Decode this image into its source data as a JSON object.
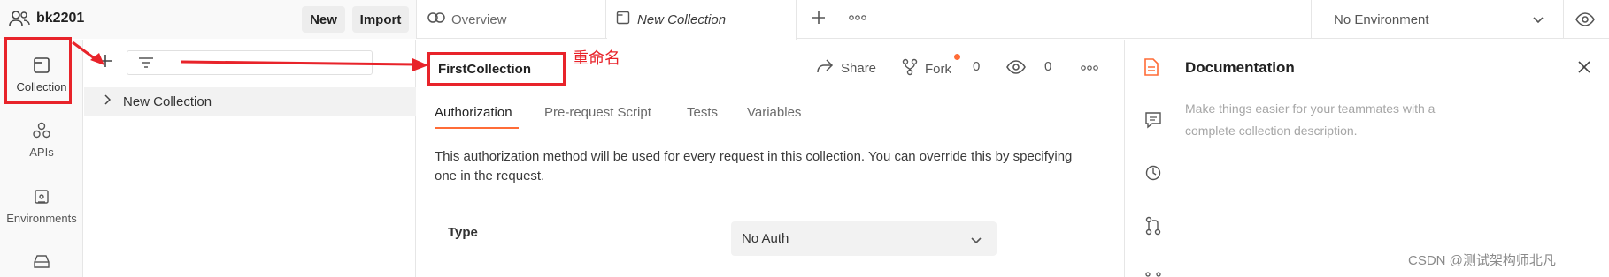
{
  "workspace": {
    "name": "bk2201",
    "new_label": "New",
    "import_label": "Import"
  },
  "tabs": [
    {
      "label": "Overview",
      "icon": "overview-icon"
    },
    {
      "label": "New Collection",
      "icon": "collection-tab-icon",
      "active": true
    }
  ],
  "environment": {
    "selected": "No Environment"
  },
  "rail": [
    {
      "label": "Collection",
      "icon": "collection-icon",
      "active": true
    },
    {
      "label": "APIs",
      "icon": "apis-icon"
    },
    {
      "label": "Environments",
      "icon": "environments-icon"
    }
  ],
  "sidebar": {
    "tree_item": "New Collection"
  },
  "collection": {
    "name_value": "FirstCollection",
    "share_label": "Share",
    "fork_label": "Fork",
    "fork_count": "0",
    "watch_count": "0"
  },
  "subtabs": [
    "Authorization",
    "Pre-request Script",
    "Tests",
    "Variables"
  ],
  "auth": {
    "description": "This authorization method will be used for every request in this collection. You can override this by specifying one in the request.",
    "type_label": "Type",
    "type_value": "No Auth"
  },
  "docs": {
    "title": "Documentation",
    "description": "Make things easier for your teammates with a complete collection description."
  },
  "annotation": {
    "rename_label": "重命名"
  },
  "watermark": "CSDN @测试架构师北凡",
  "colors": {
    "accent": "#ff6c37",
    "annotation_red": "#e8232a"
  }
}
